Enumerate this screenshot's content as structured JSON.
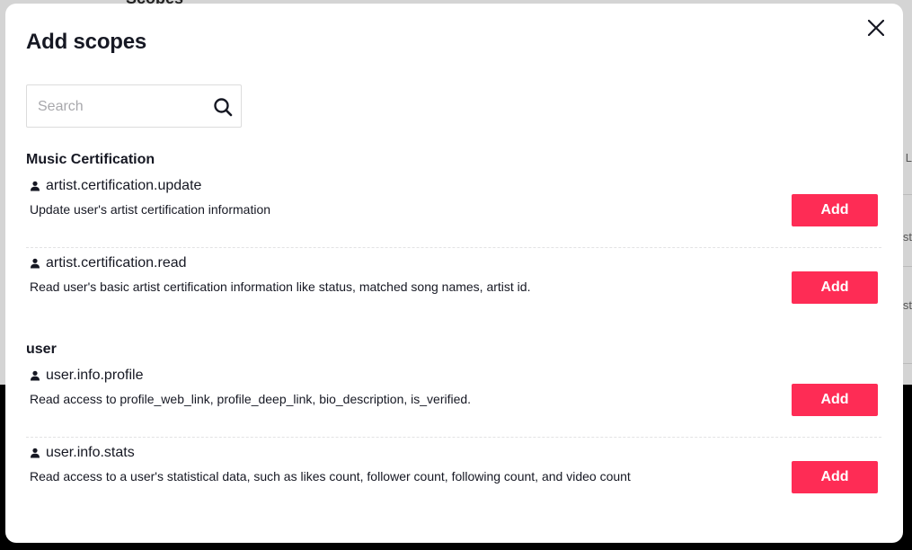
{
  "background": {
    "heading": "Scopes",
    "row_fragments": [
      "L",
      "st",
      "st"
    ]
  },
  "modal": {
    "title": "Add scopes",
    "search": {
      "placeholder": "Search",
      "value": ""
    },
    "groups": [
      {
        "title": "Music Certification",
        "scopes": [
          {
            "name": "artist.certification.update",
            "description": "Update user's artist certification information",
            "action": "Add"
          },
          {
            "name": "artist.certification.read",
            "description": "Read user's basic artist certification information like status, matched song names, artist id.",
            "action": "Add"
          }
        ]
      },
      {
        "title": "user",
        "scopes": [
          {
            "name": "user.info.profile",
            "description": "Read access to profile_web_link, profile_deep_link, bio_description, is_verified.",
            "action": "Add"
          },
          {
            "name": "user.info.stats",
            "description": "Read access to a user's statistical data, such as likes count, follower count, following count, and video count",
            "action": "Add"
          }
        ]
      }
    ]
  },
  "colors": {
    "accent": "#fe2c55",
    "text": "#161823",
    "overlay_top": "#d4d4d4",
    "overlay_bottom": "#000000"
  },
  "icons": [
    "close-icon",
    "search-icon",
    "person-icon"
  ]
}
